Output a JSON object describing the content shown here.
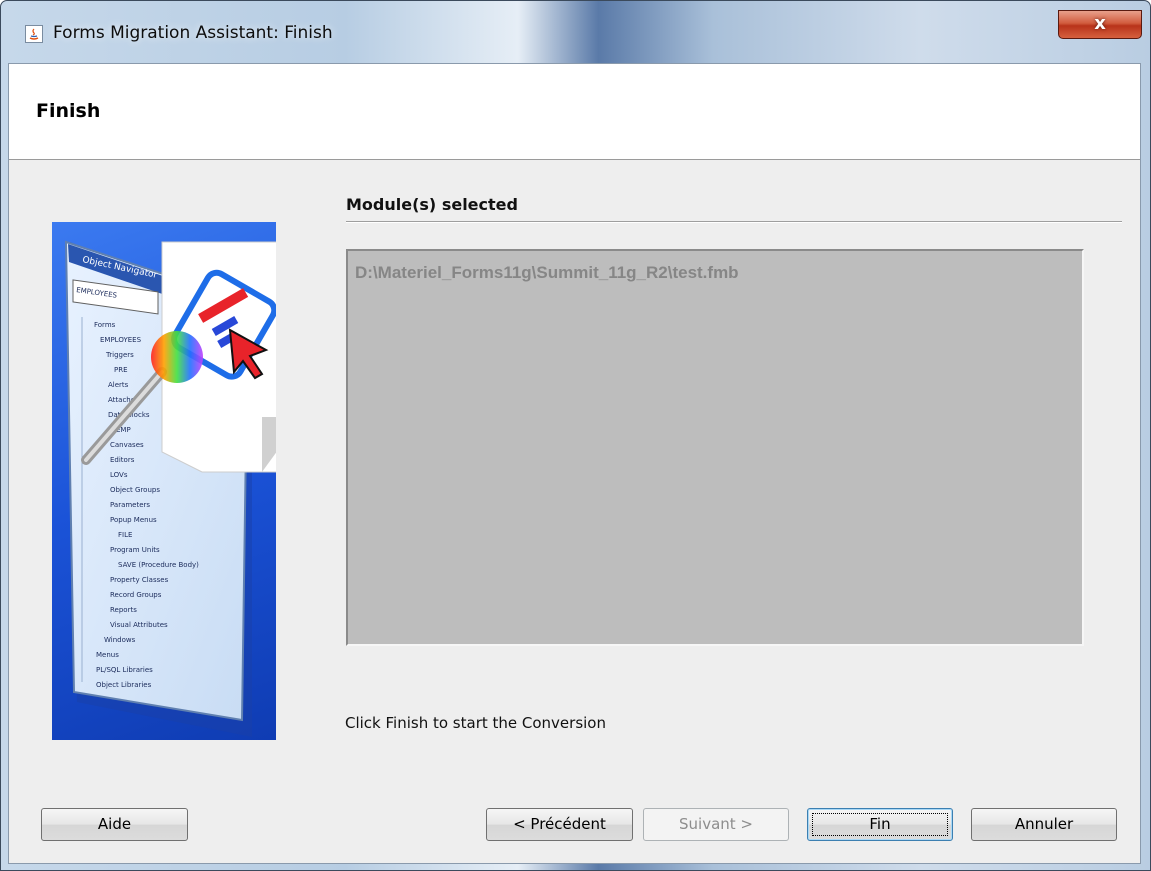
{
  "window": {
    "title": "Forms Migration Assistant: Finish",
    "close_label": "x"
  },
  "header": {
    "title": "Finish"
  },
  "illustration": {
    "panel_title": "Object Navigator",
    "combo_value": "EMPLOYEES",
    "tree_items": [
      "Forms",
      "EMPLOYEES",
      "Triggers",
      "PRE",
      "Alerts",
      "Attached",
      "Data Blocks",
      "EMP",
      "Canvases",
      "Editors",
      "LOVs",
      "Object Groups",
      "Parameters",
      "Popup Menus",
      "FILE",
      "Program Units",
      "SAVE (Procedure Body)",
      "Property Classes",
      "Record Groups",
      "Reports",
      "Visual Attributes",
      "Windows",
      "Menus",
      "PL/SQL Libraries",
      "Object Libraries"
    ]
  },
  "main": {
    "section_title": "Module(s) selected",
    "modules": [
      "D:\\Materiel_Forms11g\\Summit_11g_R2\\test.fmb"
    ],
    "instruction": "Click Finish to start the Conversion"
  },
  "buttons": {
    "help": "Aide",
    "back": "< Précédent",
    "next": "Suivant >",
    "finish": "Fin",
    "cancel": "Annuler"
  }
}
